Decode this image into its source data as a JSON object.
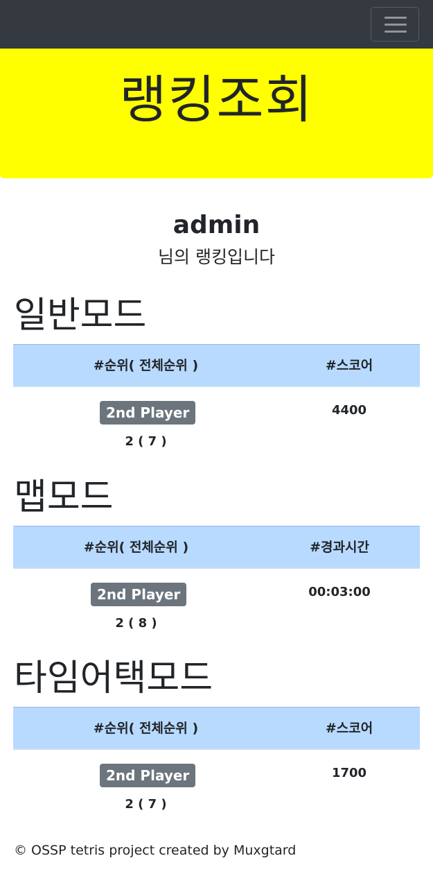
{
  "header": {
    "title": "랭킹조회"
  },
  "user": {
    "name": "admin",
    "subtitle": "님의 랭킹입니다"
  },
  "modes": [
    {
      "title": "일반모드",
      "col_rank": "#순위( 전체순위 )",
      "col_value": "#스코어",
      "badge": "2nd Player",
      "rank": "2 ( 7 )",
      "value": "4400"
    },
    {
      "title": "맵모드",
      "col_rank": "#순위( 전체순위 )",
      "col_value": "#경과시간",
      "badge": "2nd Player",
      "rank": "2 ( 8 )",
      "value": "00:03:00"
    },
    {
      "title": "타임어택모드",
      "col_rank": "#순위( 전체순위 )",
      "col_value": "#스코어",
      "badge": "2nd Player",
      "rank": "2 ( 7 )",
      "value": "1700"
    }
  ],
  "footer": {
    "text": "© OSSP tetris project created by Muxgtard"
  }
}
